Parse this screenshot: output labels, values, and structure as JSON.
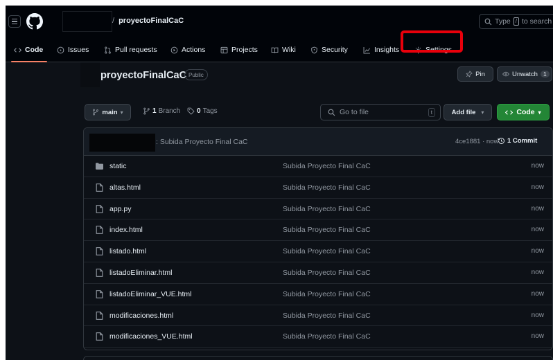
{
  "header": {
    "repo_name": "proyectoFinalCaC",
    "search_placeholder_pre": "Type",
    "search_key": "/",
    "search_placeholder_post": "to search"
  },
  "tabs": [
    {
      "label": "Code",
      "icon": "code-icon",
      "active": true
    },
    {
      "label": "Issues",
      "icon": "issue-opened-icon"
    },
    {
      "label": "Pull requests",
      "icon": "git-pull-request-icon"
    },
    {
      "label": "Actions",
      "icon": "play-icon"
    },
    {
      "label": "Projects",
      "icon": "table-icon"
    },
    {
      "label": "Wiki",
      "icon": "book-icon"
    },
    {
      "label": "Security",
      "icon": "shield-icon"
    },
    {
      "label": "Insights",
      "icon": "graph-icon"
    },
    {
      "label": "Settings",
      "icon": "gear-icon",
      "highlighted": true
    }
  ],
  "repo": {
    "name": "proyectoFinalCaC",
    "visibility": "Public",
    "pin_label": "Pin",
    "unwatch_label": "Unwatch",
    "watch_count": "1"
  },
  "branch_bar": {
    "branch": "main",
    "branch_count": "1",
    "branch_word": "Branch",
    "tag_count": "0",
    "tag_word": "Tags",
    "goto_placeholder": "Go to file",
    "goto_key": "t",
    "add_file_label": "Add file",
    "code_label": "Code"
  },
  "commit": {
    "message": "Subida Proyecto Final CaC",
    "hash_time": "4ce1881 · now",
    "count_label": "1 Commit"
  },
  "files": [
    {
      "name": "static",
      "type": "folder",
      "message": "Subida Proyecto Final CaC",
      "time": "now"
    },
    {
      "name": "altas.html",
      "type": "file",
      "message": "Subida Proyecto Final CaC",
      "time": "now"
    },
    {
      "name": "app.py",
      "type": "file",
      "message": "Subida Proyecto Final CaC",
      "time": "now"
    },
    {
      "name": "index.html",
      "type": "file",
      "message": "Subida Proyecto Final CaC",
      "time": "now"
    },
    {
      "name": "listado.html",
      "type": "file",
      "message": "Subida Proyecto Final CaC",
      "time": "now"
    },
    {
      "name": "listadoEliminar.html",
      "type": "file",
      "message": "Subida Proyecto Final CaC",
      "time": "now"
    },
    {
      "name": "listadoEliminar_VUE.html",
      "type": "file",
      "message": "Subida Proyecto Final CaC",
      "time": "now"
    },
    {
      "name": "modificaciones.html",
      "type": "file",
      "message": "Subida Proyecto Final CaC",
      "time": "now"
    },
    {
      "name": "modificaciones_VUE.html",
      "type": "file",
      "message": "Subida Proyecto Final CaC",
      "time": "now"
    }
  ],
  "colors": {
    "background": "#0d1117",
    "header_bg": "#010409",
    "accent_tab": "#f78166",
    "highlight_box": "#e8000b",
    "code_button": "#238636"
  }
}
